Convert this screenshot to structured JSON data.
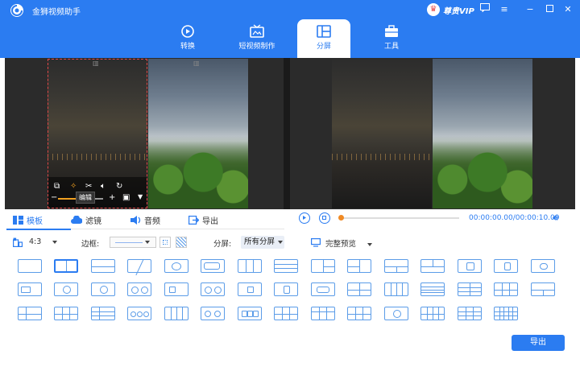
{
  "app": {
    "title": "金狮视频助手"
  },
  "vip": {
    "label": "尊贵VIP"
  },
  "window_buttons": [
    "message-icon",
    "menu-icon",
    "minimize-icon",
    "maximize-icon",
    "close-icon"
  ],
  "nav": {
    "tabs": [
      {
        "label": "转换",
        "icon": "convert-icon"
      },
      {
        "label": "短视频制作",
        "icon": "video-make-icon"
      },
      {
        "label": "分屏",
        "icon": "split-screen-icon",
        "active": true
      },
      {
        "label": "工具",
        "icon": "toolbox-icon"
      }
    ]
  },
  "editor": {
    "tooltip": "编辑"
  },
  "toolbar": {
    "template_label": "模板",
    "filter_label": "滤镜",
    "audio_label": "音频",
    "export_label": "导出"
  },
  "player": {
    "time": "00:00:00.00/00:00:10.09",
    "progress": 0
  },
  "options": {
    "ratio": "4:3",
    "border_label": "边框:",
    "split_label": "分屏:",
    "split_value": "所有分屏",
    "preview_label": "完整预览"
  },
  "layouts": {
    "count": 54,
    "selected_index": 1
  },
  "footer": {
    "export_button": "导出"
  },
  "colors": {
    "accent": "#2b7cf1",
    "layout_stroke": "#5b9ce8"
  }
}
